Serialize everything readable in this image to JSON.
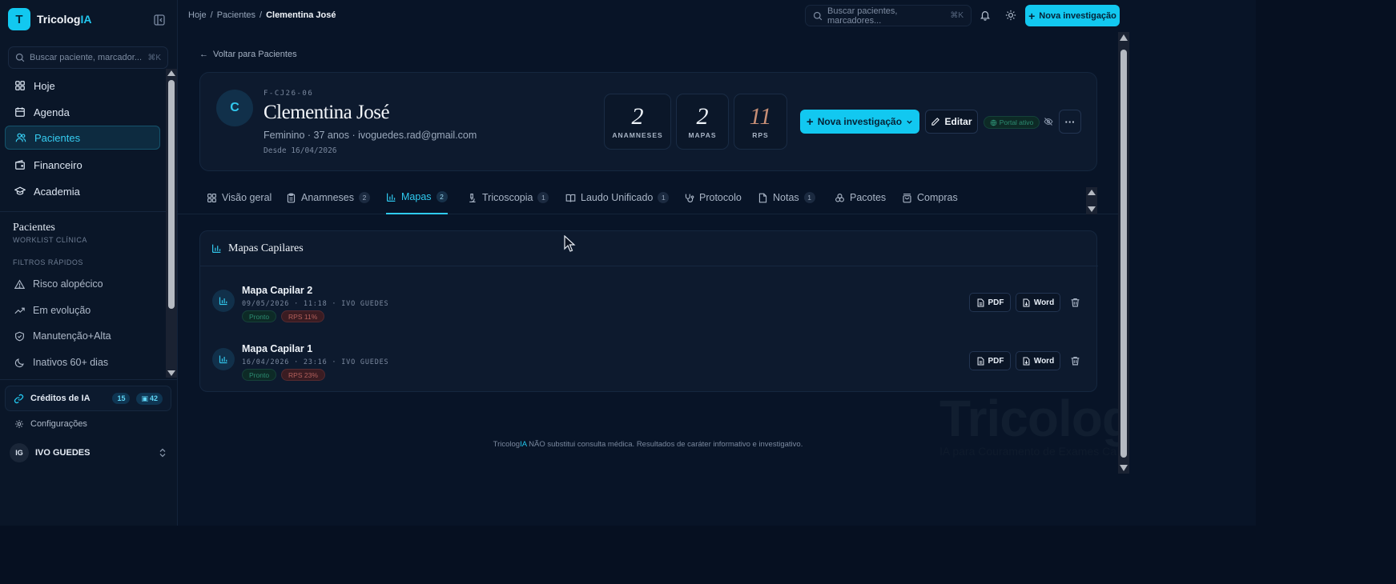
{
  "brand": {
    "logo_letter": "T",
    "name_prefix": "Tricolog",
    "name_suffix": "IA"
  },
  "sidebar": {
    "search_placeholder": "Buscar paciente, marcador...",
    "search_kbd": "⌘K",
    "nav": [
      {
        "label": "Hoje",
        "icon": "grid-icon"
      },
      {
        "label": "Agenda",
        "icon": "calendar-icon"
      },
      {
        "label": "Pacientes",
        "icon": "users-icon",
        "active": true
      },
      {
        "label": "Financeiro",
        "icon": "wallet-icon"
      },
      {
        "label": "Academia",
        "icon": "graduation-cap-icon"
      }
    ],
    "section_title": "Pacientes",
    "section_subtitle": "WORKLIST CLÍNICA",
    "filters_label": "FILTROS RÁPIDOS",
    "filters": [
      {
        "label": "Risco alopécico",
        "icon": "warning-icon"
      },
      {
        "label": "Em evolução",
        "icon": "trending-up-icon"
      },
      {
        "label": "Manutenção+Alta",
        "icon": "shield-icon"
      },
      {
        "label": "Inativos 60+ dias",
        "icon": "moon-icon"
      }
    ],
    "credits": {
      "label": "Créditos de IA",
      "count_a": "15",
      "count_b": "42"
    },
    "settings_label": "Configurações",
    "user": {
      "initials": "IG",
      "name": "IVO GUEDES"
    }
  },
  "topbar": {
    "breadcrumb": [
      "Hoje",
      "Pacientes",
      "Clementina José"
    ],
    "search_placeholder": "Buscar pacientes, marcadores...",
    "search_kbd": "⌘K",
    "new_button": "Nova investigação"
  },
  "main": {
    "back_link": "Voltar para Pacientes",
    "patient": {
      "avatar": "C",
      "code": "F-CJ26-06",
      "name": "Clementina José",
      "meta": "Feminino · 37 anos · ivoguedes.rad@gmail.com",
      "since": "Desde 16/04/2026",
      "stats": [
        {
          "value": "2",
          "label": "ANAMNESES"
        },
        {
          "value": "2",
          "label": "MAPAS"
        },
        {
          "value": "11",
          "label": "RPS"
        }
      ],
      "new_button": "Nova investigação",
      "edit_button": "Editar",
      "portal_badge": "Portal ativo"
    },
    "tabs": [
      {
        "label": "Visão geral",
        "icon": "layout-icon",
        "count": ""
      },
      {
        "label": "Anamneses",
        "icon": "clipboard-icon",
        "count": "2"
      },
      {
        "label": "Mapas",
        "icon": "bar-chart-icon",
        "count": "2",
        "active": true
      },
      {
        "label": "Tricoscopia",
        "icon": "microscope-icon",
        "count": "1"
      },
      {
        "label": "Laudo Unificado",
        "icon": "book-icon",
        "count": "1"
      },
      {
        "label": "Protocolo",
        "icon": "stethoscope-icon",
        "count": ""
      },
      {
        "label": "Notas",
        "icon": "note-icon",
        "count": "1"
      },
      {
        "label": "Pacotes",
        "icon": "package-icon",
        "count": ""
      },
      {
        "label": "Compras",
        "icon": "shopping-bag-icon",
        "count": ""
      }
    ],
    "maps_title": "Mapas Capilares",
    "maps": [
      {
        "title": "Mapa Capilar 2",
        "date": "09/05/2026 · 11:18 · IVO GUEDES",
        "status": "Pronto",
        "rps": "RPS 11%",
        "pdf": "PDF",
        "word": "Word"
      },
      {
        "title": "Mapa Capilar 1",
        "date": "16/04/2026 · 23:16 · IVO GUEDES",
        "status": "Pronto",
        "rps": "RPS 23%",
        "pdf": "PDF",
        "word": "Word"
      }
    ],
    "footer_prefix": "Tricolog",
    "footer_accent": "IA",
    "footer_text": " NÃO substitui consulta médica. Resultados de caráter informativo e investigativo.",
    "watermark": "TricologIA",
    "watermark_sub": "IA para Couramento de Exames Ca"
  },
  "colors": {
    "accent": "#12c8f0",
    "background": "#081427",
    "card": "#0d1a2e",
    "ok": "#2c8d72",
    "rps": "#b4605c"
  }
}
